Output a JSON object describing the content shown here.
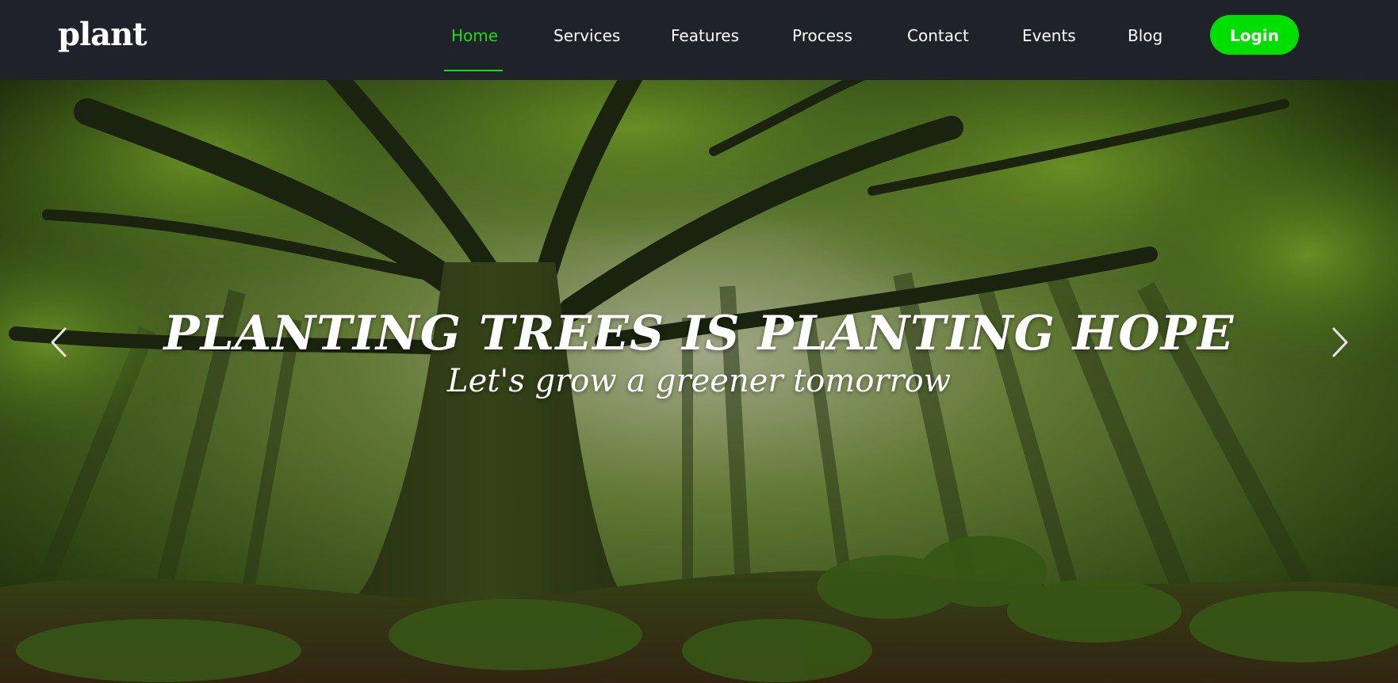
{
  "brand": {
    "logo_text": "plant"
  },
  "nav": {
    "items": [
      {
        "label": "Home",
        "active": true
      },
      {
        "label": "Services",
        "active": false
      },
      {
        "label": "Features",
        "active": false
      },
      {
        "label": "Process",
        "active": false
      },
      {
        "label": "Contact",
        "active": false
      },
      {
        "label": "Events",
        "active": false
      },
      {
        "label": "Blog",
        "active": false
      }
    ],
    "login_label": "Login"
  },
  "hero": {
    "title": "PLANTING TREES IS PLANTING HOPE",
    "subtitle": "Let's grow a greener tomorrow",
    "prev_icon": "chevron-left-icon",
    "next_icon": "chevron-right-icon"
  },
  "colors": {
    "header_bg": "#1f2228",
    "accent": "#12e012",
    "login_bg": "#00e000",
    "text": "#ffffff"
  }
}
